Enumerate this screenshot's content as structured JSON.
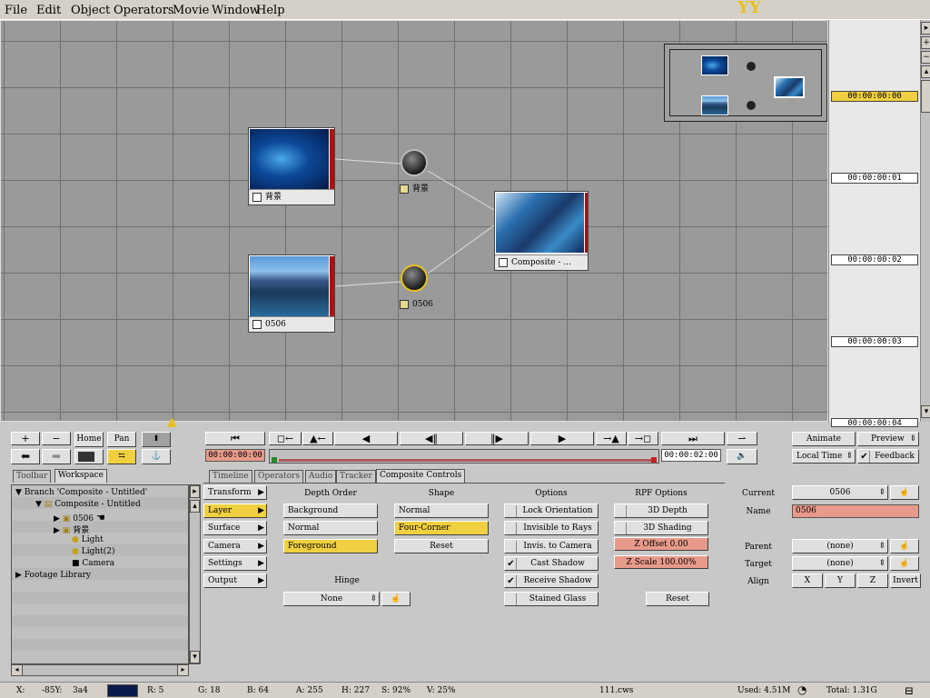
{
  "menu": [
    "File",
    "Edit",
    "Object",
    "Operators",
    "Movie",
    "Window",
    "Help"
  ],
  "workspace": {
    "nodes": [
      {
        "label": "背景"
      },
      {
        "label": "0506"
      },
      {
        "label": "Composite - ..."
      }
    ],
    "spheres": [
      {
        "label": "背景"
      },
      {
        "label": "0506"
      }
    ]
  },
  "timeline": {
    "timecodes": [
      "00:00:00:00",
      "00:00:00:01",
      "00:00:00:02",
      "00:00:00:03",
      "00:00:00:04"
    ]
  },
  "left_tools": {
    "home": "Home",
    "pan": "Pan",
    "plus": "+",
    "minus": "−"
  },
  "transport": {
    "start_time": "00:00:00:00",
    "end_time": "00:00:02:00"
  },
  "right_controls": {
    "animate": "Animate",
    "preview": "Preview",
    "local_time": "Local Time",
    "feedback": "Feedback"
  },
  "tabs": {
    "left": [
      "Toolbar",
      "Workspace"
    ],
    "right": [
      "Timeline",
      "Operators",
      "Audio",
      "Tracker",
      "Composite Controls"
    ]
  },
  "tree": [
    "Branch 'Composite - Untitled'",
    "Composite - Untitled",
    "0506",
    "背景",
    "Light",
    "Light(2)",
    "Camera",
    "Footage Library"
  ],
  "categories": [
    "Transform",
    "Layer",
    "Surface",
    "Camera",
    "Settings",
    "Output"
  ],
  "depth_order": {
    "title": "Depth Order",
    "items": [
      "Background",
      "Normal",
      "Foreground"
    ]
  },
  "shape": {
    "title": "Shape",
    "items": [
      "Normal",
      "Four-Corner"
    ],
    "reset": "Reset"
  },
  "hinge": {
    "title": "Hinge",
    "value": "None"
  },
  "options": {
    "title": "Options",
    "items": [
      "Lock Orientation",
      "Invisible to Rays",
      "Invis. to Camera",
      "Cast Shadow",
      "Receive Shadow",
      "Stained Glass"
    ]
  },
  "rpf": {
    "title": "RPF Options",
    "items": [
      "3D Depth",
      "3D Shading"
    ],
    "z_offset": "Z Offset 0.00",
    "z_scale": "Z Scale 100.00%",
    "reset": "Reset"
  },
  "object_props": {
    "current_label": "Current",
    "current_value": "0506",
    "name_label": "Name",
    "name_value": "0506",
    "parent_label": "Parent",
    "parent_value": "(none)",
    "target_label": "Target",
    "target_value": "(none)",
    "align_label": "Align",
    "align_x": "X",
    "align_y": "Y",
    "align_z": "Z",
    "invert": "Invert"
  },
  "status": {
    "x": "X:",
    "xval": "-85Y:",
    "yval": "3a4",
    "r": "R: 5",
    "g": "G: 18",
    "b": "B: 64",
    "a": "A: 255",
    "h": "H: 227",
    "s": "S: 92%",
    "v": "V: 25%",
    "file": "111.cws",
    "used": "Used: 4.51M",
    "total": "Total: 1.31G"
  },
  "colors": {
    "accent": "#f0d040",
    "pink": "#e89a8a",
    "workspace": "#9a9a9a",
    "red": "#b01010"
  }
}
